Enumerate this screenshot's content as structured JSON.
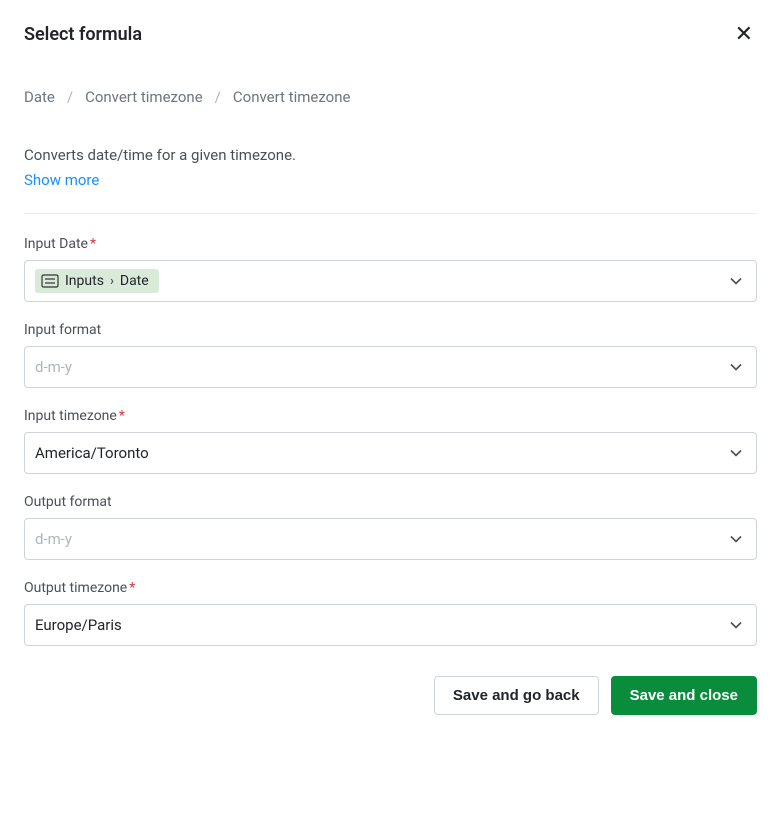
{
  "header": {
    "title": "Select formula"
  },
  "breadcrumb": {
    "items": [
      "Date",
      "Convert timezone",
      "Convert timezone"
    ],
    "separator": "/"
  },
  "description": "Converts date/time for a given timezone.",
  "show_more_label": "Show more",
  "fields": {
    "input_date": {
      "label": "Input Date",
      "required": true,
      "chip": {
        "segment1": "Inputs",
        "segment2": "Date"
      }
    },
    "input_format": {
      "label": "Input format",
      "required": false,
      "placeholder": "d-m-y",
      "value": ""
    },
    "input_timezone": {
      "label": "Input timezone",
      "required": true,
      "value": "America/Toronto"
    },
    "output_format": {
      "label": "Output format",
      "required": false,
      "placeholder": "d-m-y",
      "value": ""
    },
    "output_timezone": {
      "label": "Output timezone",
      "required": true,
      "value": "Europe/Paris"
    }
  },
  "buttons": {
    "save_back": "Save and go back",
    "save_close": "Save and close"
  }
}
